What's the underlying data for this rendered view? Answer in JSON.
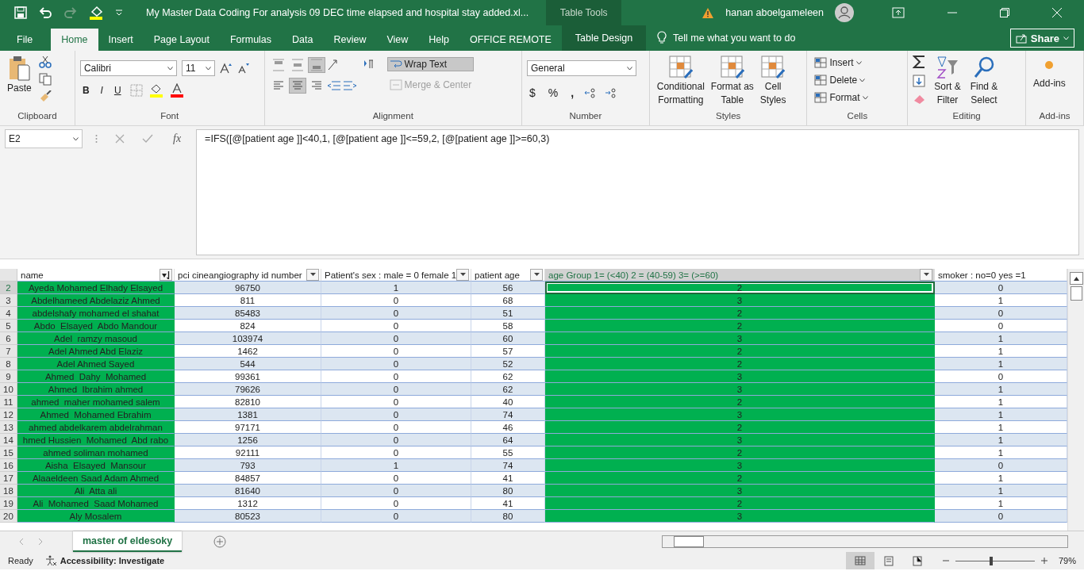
{
  "title_bar": {
    "title": "My Master Data Coding For analysis 09 DEC time elapsed and hospital stay added.xl...",
    "contextual": "Table Tools",
    "user": "hanan aboelgameleen"
  },
  "menu_tabs": [
    {
      "label": "File",
      "selected": false
    },
    {
      "label": "Home",
      "selected": true
    },
    {
      "label": "Insert",
      "selected": false
    },
    {
      "label": "Page Layout",
      "selected": false
    },
    {
      "label": "Formulas",
      "selected": false
    },
    {
      "label": "Data",
      "selected": false
    },
    {
      "label": "Review",
      "selected": false
    },
    {
      "label": "View",
      "selected": false
    },
    {
      "label": "Help",
      "selected": false
    },
    {
      "label": "OFFICE REMOTE",
      "selected": false
    },
    {
      "label": "Table Design",
      "selected": false
    }
  ],
  "tell_me": "Tell me what you want to do",
  "share": "Share",
  "ribbon": {
    "clipboard": {
      "label": "Clipboard",
      "paste": "Paste"
    },
    "font": {
      "label": "Font",
      "font_name": "Calibri",
      "font_size": "11",
      "bold": "B",
      "italic": "I",
      "underline": "U"
    },
    "alignment": {
      "label": "Alignment",
      "vertical": [
        {
          "selected": false
        },
        {
          "selected": false
        },
        {
          "selected": true
        }
      ],
      "horizontal": [
        {
          "selected": false
        },
        {
          "selected": true
        },
        {
          "selected": false
        }
      ],
      "wrap_text": "Wrap Text",
      "wrap_text_selected": true,
      "merge_center": "Merge & Center",
      "merge_disabled": true
    },
    "number": {
      "label": "Number",
      "format": "General",
      "currency": "$",
      "percent": "%",
      "comma": ","
    },
    "styles": {
      "label": "Styles",
      "buttons": [
        {
          "line1": "Conditional",
          "line2": "Formatting"
        },
        {
          "line1": "Format as",
          "line2": "Table"
        },
        {
          "line1": "Cell",
          "line2": "Styles"
        }
      ]
    },
    "cells": {
      "label": "Cells",
      "buttons": [
        "Insert",
        "Delete",
        "Format"
      ]
    },
    "editing": {
      "label": "Editing",
      "buttons": [
        {
          "line1": "Sort &",
          "line2": "Filter"
        },
        {
          "line1": "Find &",
          "line2": "Select"
        }
      ]
    },
    "addins": {
      "label": "Add-ins",
      "button": "Add-ins"
    }
  },
  "formula_bar": {
    "name_box": "E2",
    "function_label": "fx",
    "formula": "=IFS([@[patient age ]]<40,1, [@[patient age ]]<=59,2, [@[patient age ]]>=60,3)"
  },
  "sheet": {
    "columns": [
      {
        "label": "name",
        "sorted": true,
        "filter_button": true,
        "highlighted": true,
        "selected": false
      },
      {
        "label": "pci cineangiography id number",
        "filter_button": true,
        "highlighted": false,
        "selected": false
      },
      {
        "label": "Patient's sex : male = 0 female 1",
        "filter_button": true,
        "highlighted": false,
        "selected": false
      },
      {
        "label": "patient age",
        "filter_button": true,
        "highlighted": false,
        "selected": false
      },
      {
        "label": "age Group 1= (<40) 2 = (40-59) 3= (>=60)",
        "filter_button": true,
        "highlighted": true,
        "selected": true
      },
      {
        "label": "smoker : no=0 yes =1",
        "filter_button": false,
        "highlighted": false,
        "selected": false
      }
    ],
    "rows": [
      {
        "number": "2",
        "selected": true,
        "cells": [
          "Ayeda Mohamed Elhady Elsayed",
          "96750",
          "1",
          "56",
          "2",
          "0"
        ]
      },
      {
        "number": "3",
        "selected": false,
        "cells": [
          "Abdelhameed Abdelaziz Ahmed",
          "811",
          "0",
          "68",
          "3",
          "1"
        ]
      },
      {
        "number": "4",
        "selected": false,
        "cells": [
          "abdelshafy mohamed el shahat",
          "85483",
          "0",
          "51",
          "2",
          "0"
        ]
      },
      {
        "number": "5",
        "selected": false,
        "cells": [
          "Abdo  Elsayed  Abdo Mandour",
          "824",
          "0",
          "58",
          "2",
          "0"
        ]
      },
      {
        "number": "6",
        "selected": false,
        "cells": [
          "Adel  ramzy masoud",
          "103974",
          "0",
          "60",
          "3",
          "1"
        ]
      },
      {
        "number": "7",
        "selected": false,
        "cells": [
          "Adel Ahmed Abd Elaziz",
          "1462",
          "0",
          "57",
          "2",
          "1"
        ]
      },
      {
        "number": "8",
        "selected": false,
        "cells": [
          "Adel Ahmed Sayed",
          "544",
          "0",
          "52",
          "2",
          "1"
        ]
      },
      {
        "number": "9",
        "selected": false,
        "cells": [
          "Ahmed  Dahy  Mohamed",
          "99361",
          "0",
          "62",
          "3",
          "0"
        ]
      },
      {
        "number": "10",
        "selected": false,
        "cells": [
          "Ahmed  Ibrahim ahmed",
          "79626",
          "0",
          "62",
          "3",
          "1"
        ]
      },
      {
        "number": "11",
        "selected": false,
        "cells": [
          "ahmed  maher mohamed salem",
          "82810",
          "0",
          "40",
          "2",
          "1"
        ]
      },
      {
        "number": "12",
        "selected": false,
        "cells": [
          "Ahmed  Mohamed Ebrahim",
          "1381",
          "0",
          "74",
          "3",
          "1"
        ]
      },
      {
        "number": "13",
        "selected": false,
        "cells": [
          "ahmed abdelkarem abdelrahman",
          "97171",
          "0",
          "46",
          "2",
          "1"
        ]
      },
      {
        "number": "14",
        "selected": false,
        "cells": [
          "hmed Hussien  Mohamed  Abd rabo",
          "1256",
          "0",
          "64",
          "3",
          "1"
        ]
      },
      {
        "number": "15",
        "selected": false,
        "cells": [
          "ahmed soliman mohamed",
          "92111",
          "0",
          "55",
          "2",
          "1"
        ]
      },
      {
        "number": "16",
        "selected": false,
        "cells": [
          "Aisha  Elsayed  Mansour",
          "793",
          "1",
          "74",
          "3",
          "0"
        ]
      },
      {
        "number": "17",
        "selected": false,
        "cells": [
          "Alaaeldeen Saad Adam Ahmed",
          "84857",
          "0",
          "41",
          "2",
          "1"
        ]
      },
      {
        "number": "18",
        "selected": false,
        "cells": [
          "Ali  Atta ali",
          "81640",
          "0",
          "80",
          "3",
          "1"
        ]
      },
      {
        "number": "19",
        "selected": false,
        "cells": [
          "Ali  Mohamed  Saad Mohamed",
          "1312",
          "0",
          "41",
          "2",
          "1"
        ]
      },
      {
        "number": "20",
        "selected": false,
        "cells": [
          "Aly Mosalem",
          "80523",
          "0",
          "80",
          "3",
          "0"
        ]
      }
    ]
  },
  "sheet_tabs": [
    {
      "label": "master of eldesoky",
      "selected": true
    }
  ],
  "status_bar": {
    "ready": "Ready",
    "accessibility": "Accessibility: Investigate",
    "views": [
      {
        "kind": "normal",
        "selected": true
      },
      {
        "kind": "page-layout",
        "selected": false
      },
      {
        "kind": "page-break",
        "selected": false
      }
    ],
    "zoom_slider": {
      "level": 0.45
    },
    "zoom": "79%"
  }
}
